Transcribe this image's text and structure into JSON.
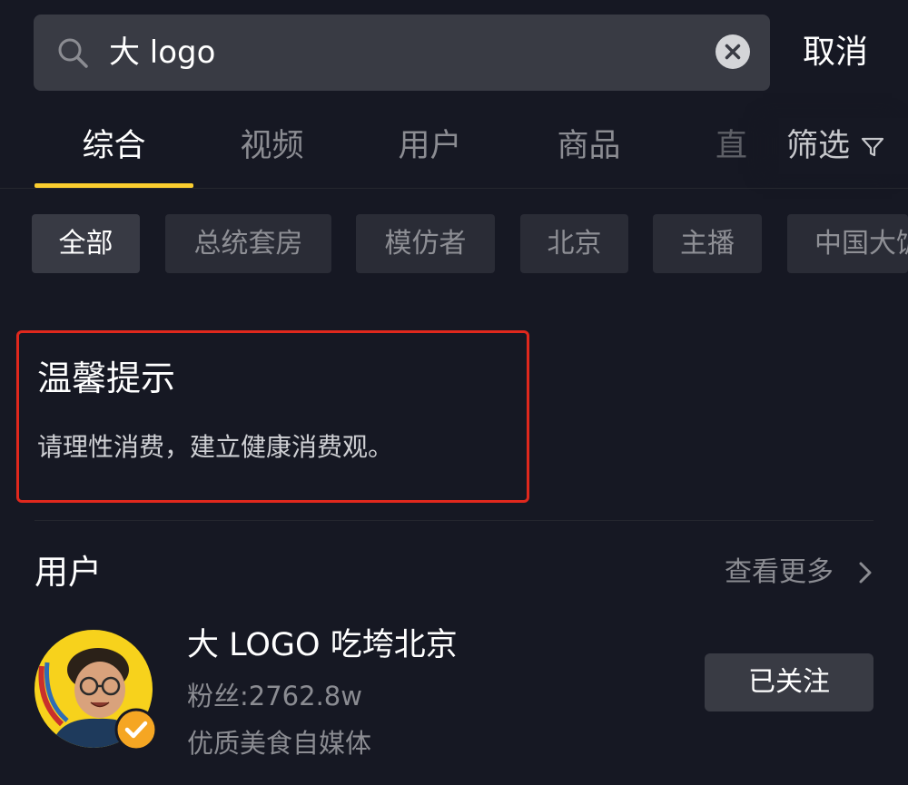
{
  "search": {
    "query": "大 logo",
    "cancel_label": "取消"
  },
  "tabs": [
    {
      "label": "综合",
      "active": true
    },
    {
      "label": "视频",
      "active": false
    },
    {
      "label": "用户",
      "active": false
    },
    {
      "label": "商品",
      "active": false
    },
    {
      "label": "直",
      "active": false
    }
  ],
  "filter": {
    "label": "筛选"
  },
  "chips": [
    {
      "label": "全部",
      "active": true
    },
    {
      "label": "总统套房",
      "active": false
    },
    {
      "label": "模仿者",
      "active": false
    },
    {
      "label": "北京",
      "active": false
    },
    {
      "label": "主播",
      "active": false
    },
    {
      "label": "中国大饭",
      "active": false
    }
  ],
  "notice": {
    "title": "温馨提示",
    "body": "请理性消费，建立健康消费观。"
  },
  "users_section": {
    "title": "用户",
    "see_more_label": "查看更多"
  },
  "user": {
    "name": "大 LOGO 吃垮北京",
    "fans": "粉丝:2762.8w",
    "description": "优质美食自媒体",
    "follow_label": "已关注",
    "verified": true
  },
  "colors": {
    "background": "#161823",
    "accent": "#fbce2f",
    "notice_border": "#e0281d",
    "verified_badge": "#f5a623",
    "avatar_bg": "#f7d21c"
  }
}
